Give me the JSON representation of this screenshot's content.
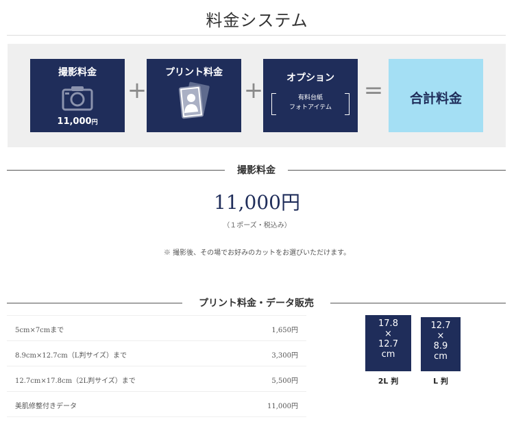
{
  "page": {
    "title": "料金システム"
  },
  "pricing": {
    "shoot": {
      "title": "撮影料金",
      "price": "11,000",
      "yen": "円",
      "icon": "camera-icon"
    },
    "print": {
      "title": "プリント料金",
      "icon": "photo-portrait-icon"
    },
    "option": {
      "title": "オプション",
      "line1": "有料台紙",
      "line2": "フォトアイテム"
    },
    "total": {
      "title": "合計料金"
    },
    "plus": "+",
    "equals": "="
  },
  "shoot_section": {
    "heading": "撮影料金",
    "price": "11,000円",
    "note": "（１ポーズ・税込み）",
    "caption": "※ 撮影後、その場でお好みのカットをお選びいただけます。"
  },
  "print_section": {
    "heading": "プリント料金・データ販売",
    "rows": [
      {
        "label": "5cm×7cmまで",
        "price": "1,650円"
      },
      {
        "label": "8.9cm×12.7cm（L判サイズ）まで",
        "price": "3,300円"
      },
      {
        "label": "12.7cm×17.8cm（2L判サイズ）まで",
        "price": "5,500円"
      },
      {
        "label": "美肌修整付きデータ",
        "price": "11,000円"
      }
    ],
    "sizes": [
      {
        "w": "17.8",
        "x": "×",
        "h": "12.7",
        "unit": "cm",
        "label": "2L 判"
      },
      {
        "w": "12.7",
        "x": "×",
        "h": "8.9",
        "unit": "cm",
        "label": "L 判"
      }
    ]
  },
  "colors": {
    "navy": "#1f2d5a",
    "light_blue": "#a4dff4",
    "band_gray": "#efefef"
  }
}
